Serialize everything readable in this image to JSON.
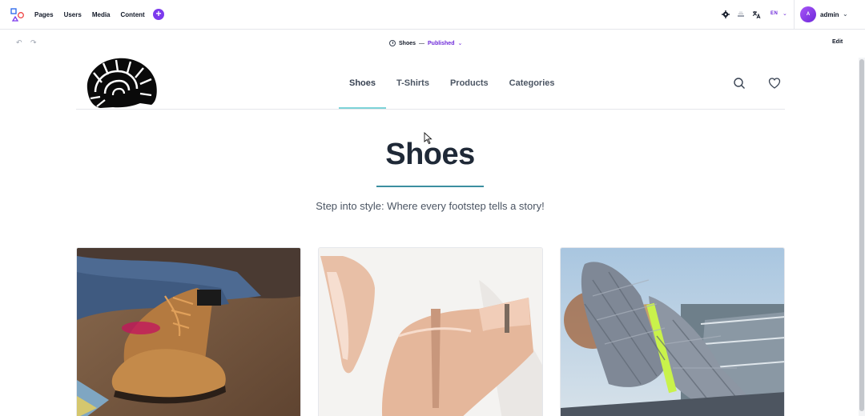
{
  "cms": {
    "nav": [
      "Pages",
      "Users",
      "Media",
      "Content"
    ],
    "add_label": "+",
    "language": "EN",
    "avatar_initial": "A",
    "user_name": "admin",
    "page_name": "Shoes",
    "page_status": "Published",
    "separator": "—",
    "edit_label": "Edit",
    "accent_color": "#7c3aed"
  },
  "site": {
    "nav": [
      {
        "label": "Shoes",
        "active": true
      },
      {
        "label": "T-Shirts",
        "active": false
      },
      {
        "label": "Products",
        "active": false
      },
      {
        "label": "Categories",
        "active": false
      }
    ],
    "hero_title": "Shoes",
    "hero_subtitle": "Step into style: Where every footstep tells a story!",
    "accent_color": "#7dd3d8",
    "cards": [
      {
        "image": "brown-leather-boot-photo"
      },
      {
        "image": "nude-patent-heel-photo"
      },
      {
        "image": "grey-mesh-sneaker-photo"
      }
    ]
  }
}
